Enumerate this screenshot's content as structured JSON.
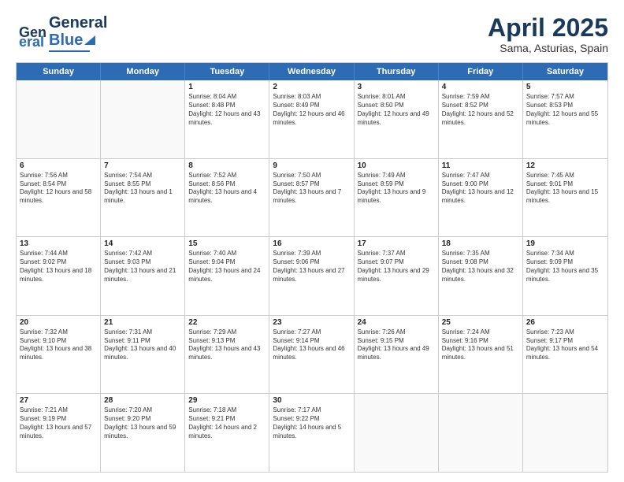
{
  "header": {
    "logo_line1": "General",
    "logo_line2": "Blue",
    "title": "April 2025",
    "subtitle": "Sama, Asturias, Spain"
  },
  "weekdays": [
    "Sunday",
    "Monday",
    "Tuesday",
    "Wednesday",
    "Thursday",
    "Friday",
    "Saturday"
  ],
  "weeks": [
    [
      {
        "day": "",
        "info": ""
      },
      {
        "day": "",
        "info": ""
      },
      {
        "day": "1",
        "info": "Sunrise: 8:04 AM\nSunset: 8:48 PM\nDaylight: 12 hours and 43 minutes."
      },
      {
        "day": "2",
        "info": "Sunrise: 8:03 AM\nSunset: 8:49 PM\nDaylight: 12 hours and 46 minutes."
      },
      {
        "day": "3",
        "info": "Sunrise: 8:01 AM\nSunset: 8:50 PM\nDaylight: 12 hours and 49 minutes."
      },
      {
        "day": "4",
        "info": "Sunrise: 7:59 AM\nSunset: 8:52 PM\nDaylight: 12 hours and 52 minutes."
      },
      {
        "day": "5",
        "info": "Sunrise: 7:57 AM\nSunset: 8:53 PM\nDaylight: 12 hours and 55 minutes."
      }
    ],
    [
      {
        "day": "6",
        "info": "Sunrise: 7:56 AM\nSunset: 8:54 PM\nDaylight: 12 hours and 58 minutes."
      },
      {
        "day": "7",
        "info": "Sunrise: 7:54 AM\nSunset: 8:55 PM\nDaylight: 13 hours and 1 minute."
      },
      {
        "day": "8",
        "info": "Sunrise: 7:52 AM\nSunset: 8:56 PM\nDaylight: 13 hours and 4 minutes."
      },
      {
        "day": "9",
        "info": "Sunrise: 7:50 AM\nSunset: 8:57 PM\nDaylight: 13 hours and 7 minutes."
      },
      {
        "day": "10",
        "info": "Sunrise: 7:49 AM\nSunset: 8:59 PM\nDaylight: 13 hours and 9 minutes."
      },
      {
        "day": "11",
        "info": "Sunrise: 7:47 AM\nSunset: 9:00 PM\nDaylight: 13 hours and 12 minutes."
      },
      {
        "day": "12",
        "info": "Sunrise: 7:45 AM\nSunset: 9:01 PM\nDaylight: 13 hours and 15 minutes."
      }
    ],
    [
      {
        "day": "13",
        "info": "Sunrise: 7:44 AM\nSunset: 9:02 PM\nDaylight: 13 hours and 18 minutes."
      },
      {
        "day": "14",
        "info": "Sunrise: 7:42 AM\nSunset: 9:03 PM\nDaylight: 13 hours and 21 minutes."
      },
      {
        "day": "15",
        "info": "Sunrise: 7:40 AM\nSunset: 9:04 PM\nDaylight: 13 hours and 24 minutes."
      },
      {
        "day": "16",
        "info": "Sunrise: 7:39 AM\nSunset: 9:06 PM\nDaylight: 13 hours and 27 minutes."
      },
      {
        "day": "17",
        "info": "Sunrise: 7:37 AM\nSunset: 9:07 PM\nDaylight: 13 hours and 29 minutes."
      },
      {
        "day": "18",
        "info": "Sunrise: 7:35 AM\nSunset: 9:08 PM\nDaylight: 13 hours and 32 minutes."
      },
      {
        "day": "19",
        "info": "Sunrise: 7:34 AM\nSunset: 9:09 PM\nDaylight: 13 hours and 35 minutes."
      }
    ],
    [
      {
        "day": "20",
        "info": "Sunrise: 7:32 AM\nSunset: 9:10 PM\nDaylight: 13 hours and 38 minutes."
      },
      {
        "day": "21",
        "info": "Sunrise: 7:31 AM\nSunset: 9:11 PM\nDaylight: 13 hours and 40 minutes."
      },
      {
        "day": "22",
        "info": "Sunrise: 7:29 AM\nSunset: 9:13 PM\nDaylight: 13 hours and 43 minutes."
      },
      {
        "day": "23",
        "info": "Sunrise: 7:27 AM\nSunset: 9:14 PM\nDaylight: 13 hours and 46 minutes."
      },
      {
        "day": "24",
        "info": "Sunrise: 7:26 AM\nSunset: 9:15 PM\nDaylight: 13 hours and 49 minutes."
      },
      {
        "day": "25",
        "info": "Sunrise: 7:24 AM\nSunset: 9:16 PM\nDaylight: 13 hours and 51 minutes."
      },
      {
        "day": "26",
        "info": "Sunrise: 7:23 AM\nSunset: 9:17 PM\nDaylight: 13 hours and 54 minutes."
      }
    ],
    [
      {
        "day": "27",
        "info": "Sunrise: 7:21 AM\nSunset: 9:19 PM\nDaylight: 13 hours and 57 minutes."
      },
      {
        "day": "28",
        "info": "Sunrise: 7:20 AM\nSunset: 9:20 PM\nDaylight: 13 hours and 59 minutes."
      },
      {
        "day": "29",
        "info": "Sunrise: 7:18 AM\nSunset: 9:21 PM\nDaylight: 14 hours and 2 minutes."
      },
      {
        "day": "30",
        "info": "Sunrise: 7:17 AM\nSunset: 9:22 PM\nDaylight: 14 hours and 5 minutes."
      },
      {
        "day": "",
        "info": ""
      },
      {
        "day": "",
        "info": ""
      },
      {
        "day": "",
        "info": ""
      }
    ]
  ]
}
